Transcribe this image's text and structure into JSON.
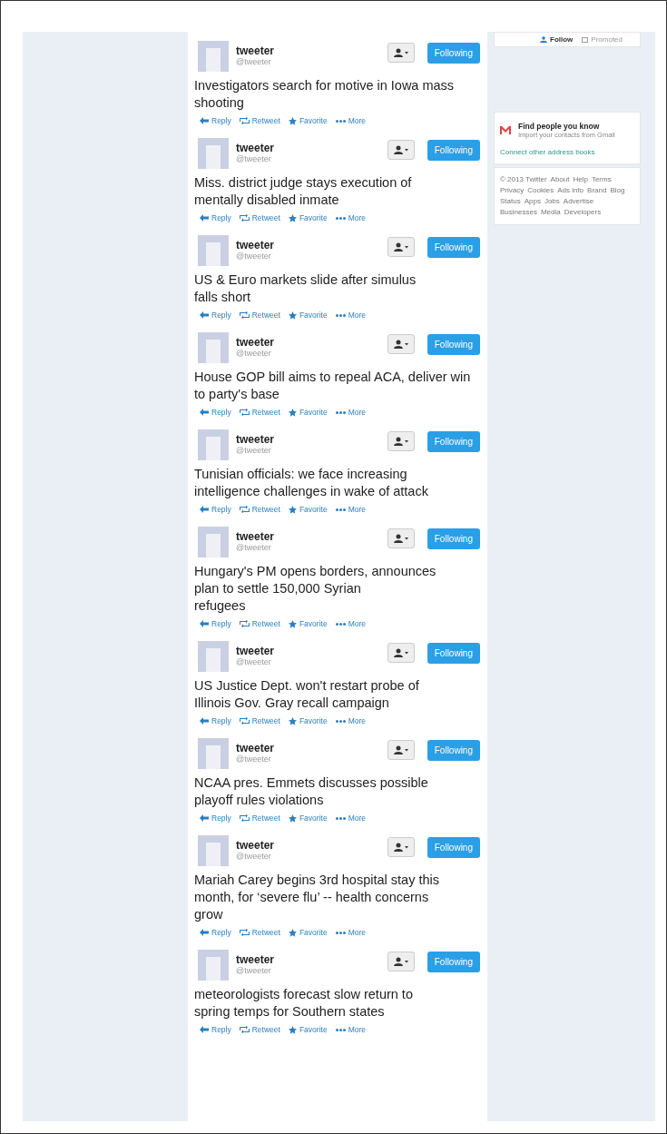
{
  "sidebar": {
    "top_card": {
      "follow": "Follow",
      "promoted": "Promoted"
    },
    "find_people": {
      "title": "Find people you know",
      "subtitle": "Import your contacts from Gmail",
      "link": "Connect other address books"
    },
    "footer_links": [
      "© 2013 Twitter",
      "About",
      "Help",
      "Terms",
      "Privacy",
      "Cookies",
      "Ads info",
      "Brand",
      "Blog",
      "Status",
      "Apps",
      "Jobs",
      "Advertise",
      "Businesses",
      "Media",
      "Developers"
    ]
  },
  "tweets": [
    {
      "name": "tweeter",
      "handle": "@tweeter",
      "following": "Following",
      "lines": [
        "Investigators search for motive in Iowa mass",
        "shooting"
      ],
      "actions": [
        "Reply",
        "Retweet",
        "Favorite",
        "More"
      ]
    },
    {
      "name": "tweeter",
      "handle": "@tweeter",
      "following": "Following",
      "lines": [
        "Miss. district judge stays execution of",
        "mentally disabled inmate"
      ],
      "actions": [
        "Reply",
        "Retweet",
        "Favorite",
        "More"
      ]
    },
    {
      "name": "tweeter",
      "handle": "@tweeter",
      "following": "Following",
      "lines": [
        "US & Euro markets slide after simulus",
        "falls short"
      ],
      "actions": [
        "Reply",
        "Retweet",
        "Favorite",
        "More"
      ]
    },
    {
      "name": "tweeter",
      "handle": "@tweeter",
      "following": "Following",
      "lines": [
        "House GOP bill aims to repeal ACA, deliver win",
        "to party's base"
      ],
      "actions": [
        "Reply",
        "Retweet",
        "Favorite",
        "More"
      ]
    },
    {
      "name": "tweeter",
      "handle": "@tweeter",
      "following": "Following",
      "lines": [
        "Tunisian officials: we face increasing",
        "intelligence challenges in wake of attack"
      ],
      "actions": [
        "Reply",
        "Retweet",
        "Favorite",
        "More"
      ]
    },
    {
      "name": "tweeter",
      "handle": "@tweeter",
      "following": "Following",
      "lines": [
        "Hungary's PM opens borders, announces",
        "plan to settle 150,000 Syrian",
        "refugees"
      ],
      "actions": [
        "Reply",
        "Retweet",
        "Favorite",
        "More"
      ]
    },
    {
      "name": "tweeter",
      "handle": "@tweeter",
      "following": "Following",
      "lines": [
        "US Justice Dept. won't restart probe of",
        "Illinois Gov. Gray recall campaign"
      ],
      "actions": [
        "Reply",
        "Retweet",
        "Favorite",
        "More"
      ]
    },
    {
      "name": "tweeter",
      "handle": "@tweeter",
      "following": "Following",
      "lines": [
        "NCAA pres. Emmets discusses possible",
        "playoff rules violations"
      ],
      "actions": [
        "Reply",
        "Retweet",
        "Favorite",
        "More"
      ]
    },
    {
      "name": "tweeter",
      "handle": "@tweeter",
      "following": "Following",
      "lines": [
        "Mariah Carey begins 3rd hospital stay this",
        "month, for ‘severe flu’ -- health concerns",
        "grow"
      ],
      "actions": [
        "Reply",
        "Retweet",
        "Favorite",
        "More"
      ]
    },
    {
      "name": "tweeter",
      "handle": "@tweeter",
      "following": "Following",
      "lines": [
        "meteorologists forecast slow return to",
        "spring temps for Southern states"
      ],
      "actions": [
        "Reply",
        "Retweet",
        "Favorite",
        "More"
      ]
    }
  ]
}
